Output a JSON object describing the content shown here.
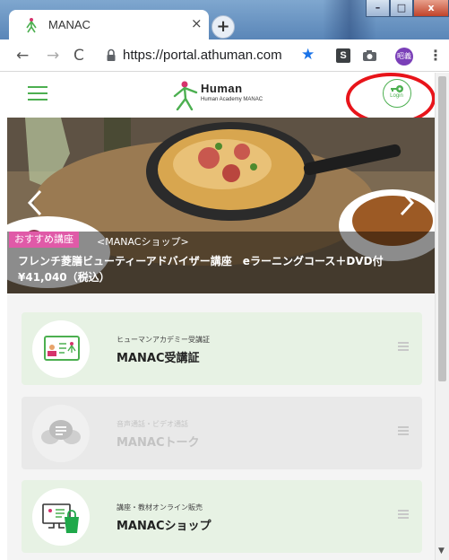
{
  "browser": {
    "tab_title": "MANAC",
    "tab_close": "×",
    "new_tab": "+",
    "url": "https://portal.athuman.com",
    "profile": "昭義",
    "window_controls": {
      "minimize": "–",
      "maximize": "□",
      "close": "x"
    }
  },
  "header": {
    "logo_main": "Human",
    "logo_sub": "Human Academy MANAC",
    "login_label": "Login",
    "accent_color": "#4caf50"
  },
  "hero": {
    "badge": "おすすめ講座",
    "shop_tag": "<MANACショップ>",
    "title": "フレンチ菱膳ビューティーアドバイザー講座　eラーニングコース＋DVD付　¥41,040（税込）"
  },
  "cards": [
    {
      "subtitle": "ヒューマンアカデミー受講証",
      "title": "MANAC受講証",
      "icon": "id-card-icon",
      "enabled": true
    },
    {
      "subtitle": "音声通話・ビデオ通話",
      "title": "MANACトーク",
      "icon": "chat-bubbles-icon",
      "enabled": false
    },
    {
      "subtitle": "講座・教材オンライン販売",
      "title": "MANACショップ",
      "icon": "shopping-bag-icon",
      "enabled": true
    }
  ],
  "annotation": {
    "color": "#e8141a"
  }
}
